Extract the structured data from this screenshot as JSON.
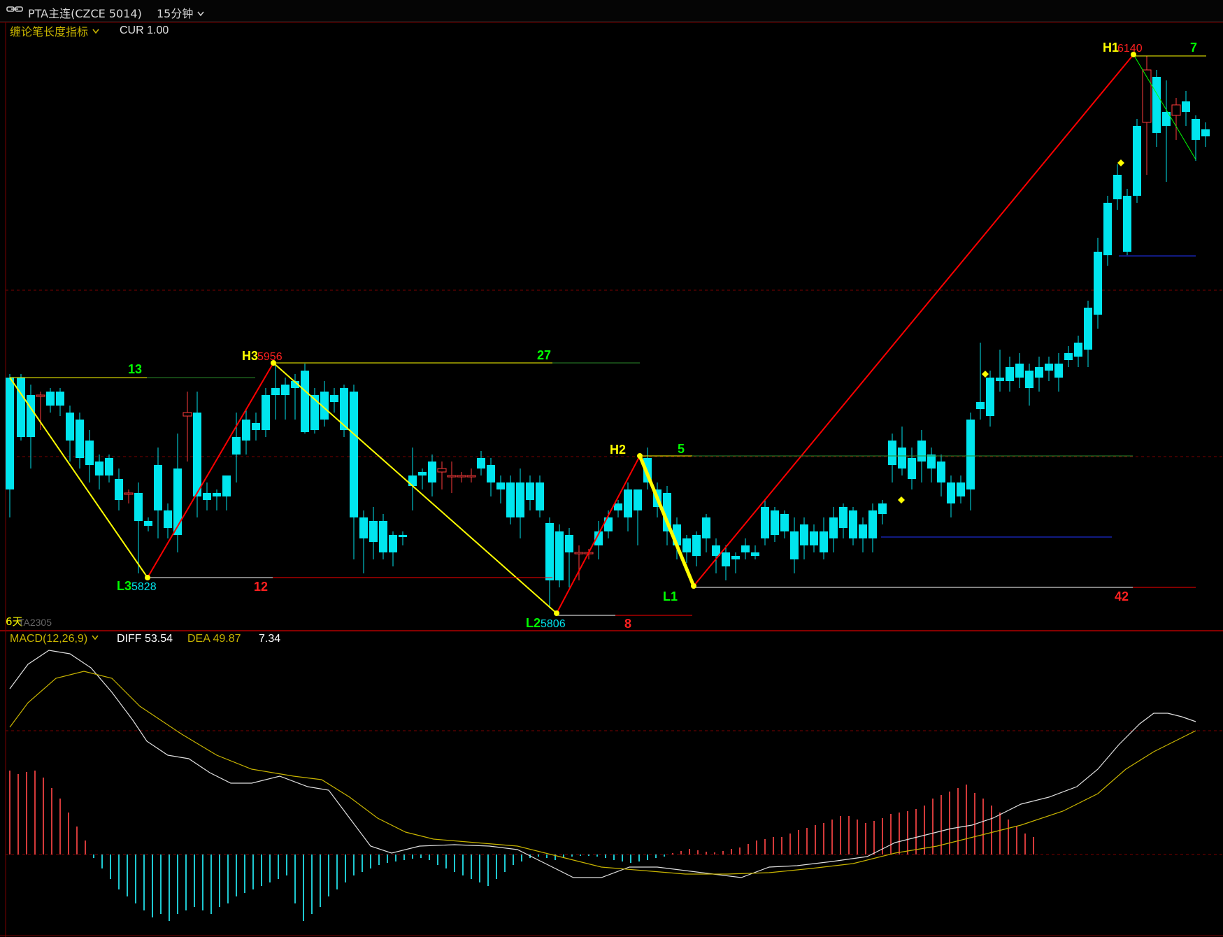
{
  "topbar": {
    "symbol_icon": "link-icon",
    "title": "PTA主连(CZCE 5014)",
    "period": "15分钟",
    "period_icon": "chevron-down-icon"
  },
  "main_panel": {
    "indicator_name": "缠论笔长度指标",
    "cur_label": "CUR 1.00",
    "contract_label": "6天",
    "contract_code": "TA2305"
  },
  "macd_panel": {
    "title": "MACD(12,26,9)",
    "diff": "DIFF 53.54",
    "dea": "DEA 49.87",
    "macd": "7.34"
  },
  "colors": {
    "bull": "#ff3b3b",
    "bear": "#00e5ee",
    "stroke_yellow": "#ffff00",
    "stroke_red": "#ff0000",
    "grid": "#7a0000",
    "label_green": "#00ff00",
    "label_yellow": "#ffff00",
    "label_red": "#ff2020",
    "blue_line": "#2233ff",
    "diff_line": "#e0e0e0",
    "dea_line": "#c8b400"
  },
  "chart_data": {
    "type": "candlestick",
    "pivots": [
      {
        "label": "H3",
        "price": "5956"
      },
      {
        "label": "L3",
        "price": "5828"
      },
      {
        "label": "H2",
        "price": ""
      },
      {
        "label": "L2",
        "price": "5806"
      },
      {
        "label": "H1",
        "price": "6140"
      },
      {
        "label": "L1",
        "price": ""
      }
    ],
    "stroke_lengths": [
      "13",
      "12",
      "27",
      "8",
      "5",
      "42",
      "7"
    ]
  }
}
